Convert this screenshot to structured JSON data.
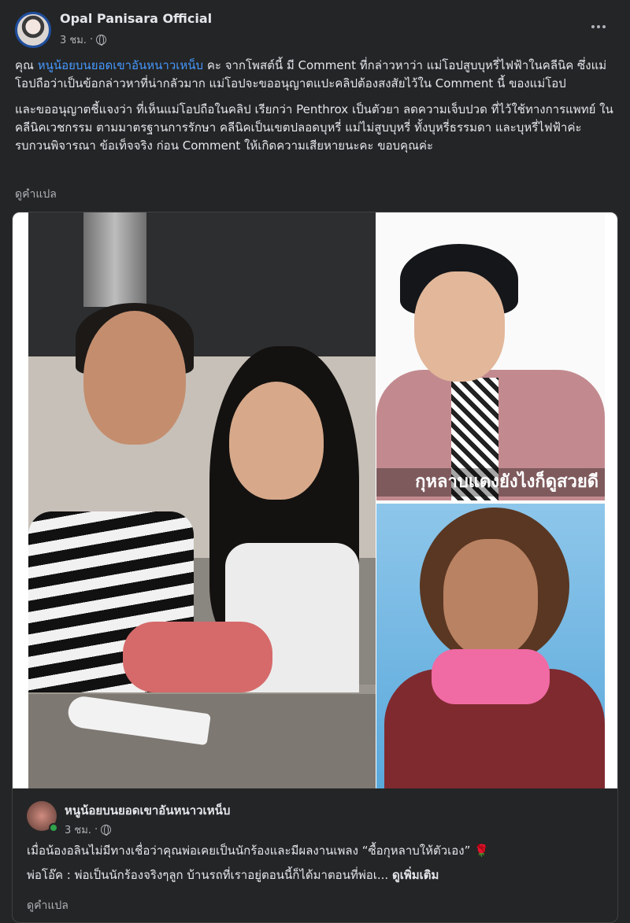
{
  "header": {
    "page_name": "Opal Panisara Official",
    "time": "3 ชม.",
    "separator": "·"
  },
  "post": {
    "paragraph1_prefix": "คุณ ",
    "paragraph1_mention": "หนูน้อยบนยอดเขาอันหนาวเหน็บ",
    "paragraph1_rest": " คะ จากโพสต์นี้ มี Comment ที่กล่าวหาว่า แม่โอปสูบบุหรี่ไฟฟ้าในคลีนิค ซึ่งแม่โอปถือว่าเป็นข้อกล่าวหาที่น่ากลัวมาก แม่โอปจะขออนุญาตแปะคลิปต้องสงสัยไว้ใน Comment นี้ ของแม่โอป",
    "paragraph2": "และขออนุญาตชี้แจงว่า ที่เห็นแม่โอปถือในคลิป เรียกว่า Penthrox เป็นตัวยา ลดความเจ็บปวด ที่ไว้ใช้ทางการแพทย์ ในคลีนิคเวชกรรม ตามมาตรฐานการรักษา คลีนิคเป็นเขตปลอดบุหรี่ แม่ไม่สูบบุหรี่ ทั้งบุหรี่ธรรมดา และบุหรี่ไฟฟ้าค่ะ รบกวนพิจารณา ข้อเท็จจริง ก่อน Comment ให้เกิดความเสียหายนะคะ ขอบคุณค่ะ",
    "see_translation": "ดูคำแปล"
  },
  "shared": {
    "photo_caption": "กุหลาบแดงยังไงก็ดูสวยดี",
    "author_name": "หนูน้อยบนยอดเขาอันหนาวเหน็บ",
    "time": "3 ชม.",
    "separator": "·",
    "line1": "เมื่อน้องอลินไม่มีทางเชื่อว่าคุณพ่อเคยเป็นนักร้องและมีผลงานเพลง “ซื้อกุหลาบให้ตัวเอง”",
    "rose_emoji": "🌹",
    "line2": "พ่อโอ๊ค : พ่อเป็นนักร้องจริงๆลูก บ้านรถที่เราอยู่ตอนนี้ก็ได้มาตอนที่พ่อเ...",
    "see_more": "ดูเพิ่มเติม",
    "see_translation": "ดูคำแปล"
  },
  "colors": {
    "background": "#242526",
    "text": "#e4e6eb",
    "secondary": "#b0b3b8",
    "mention": "#4599ff",
    "online": "#31a24c"
  },
  "icons": [
    "globe-icon",
    "more-options-icon",
    "rose-emoji"
  ]
}
